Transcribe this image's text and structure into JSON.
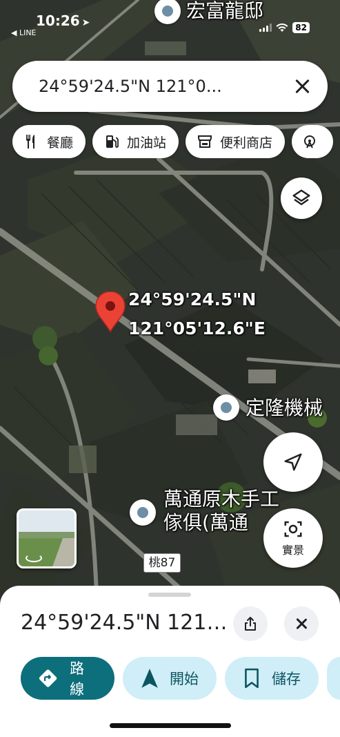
{
  "status": {
    "time": "10:26",
    "back_app": "◀ LINE",
    "battery": "82"
  },
  "search": {
    "value": "24°59'24.5\"N 121°0..."
  },
  "chips": [
    {
      "label": "餐廳",
      "icon": "restaurant-icon"
    },
    {
      "label": "加油站",
      "icon": "gas-station-icon"
    },
    {
      "label": "便利商店",
      "icon": "store-icon"
    }
  ],
  "map": {
    "pin_label_lat": "24°59'24.5\"N",
    "pin_label_lng": "121°05'12.6\"E",
    "places": [
      {
        "name": "宏富龍邸"
      },
      {
        "name": "定隆機械"
      },
      {
        "name_line1": "萬通原木手工",
        "name_line2": "傢俱(萬通"
      }
    ],
    "road_shield": "桃87"
  },
  "buttons": {
    "streetview_label": "實景"
  },
  "sheet": {
    "title": "24°59'24.5\"N 121°...",
    "actions": [
      {
        "label": "路線",
        "icon": "directions-icon"
      },
      {
        "label": "開始",
        "icon": "navigation-arrow-icon"
      },
      {
        "label": "儲存",
        "icon": "bookmark-icon"
      }
    ]
  },
  "colors": {
    "primary_action": "#0d6f7c",
    "secondary_action_bg": "#cfeef7",
    "pin_red": "#ea4335"
  }
}
